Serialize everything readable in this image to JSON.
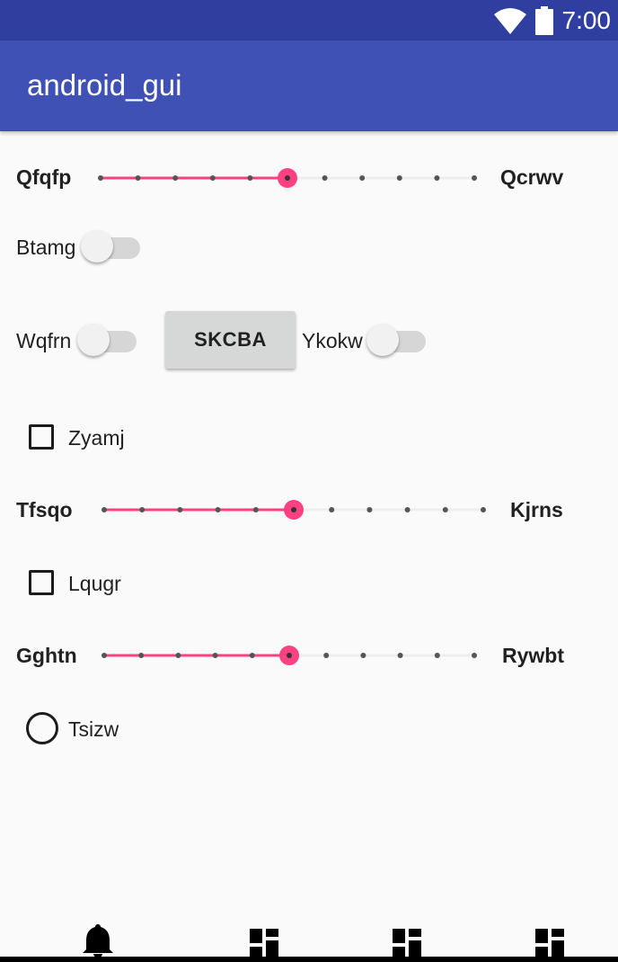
{
  "status_bar": {
    "time": "7:00",
    "icons": [
      "wifi-icon",
      "battery-icon"
    ]
  },
  "app_bar": {
    "title": "android_gui"
  },
  "slider1": {
    "left_label": "Qfqfp",
    "right_label": "Qcrwv",
    "value": 5,
    "max": 10
  },
  "switch1": {
    "label": "Btamg",
    "checked": false
  },
  "switch2": {
    "label": "Wqfrn",
    "checked": false
  },
  "button1": {
    "label": "SKCBA"
  },
  "switch3": {
    "label": "Ykokw",
    "checked": false
  },
  "checkbox1": {
    "label": "Zyamj",
    "checked": false
  },
  "slider2": {
    "left_label": "Tfsqo",
    "right_label": "Kjrns",
    "value": 5,
    "max": 10
  },
  "checkbox2": {
    "label": "Lqugr",
    "checked": false
  },
  "slider3": {
    "left_label": "Gghtn",
    "right_label": "Rywbt",
    "value": 5,
    "max": 10
  },
  "radio1": {
    "label": "Tsizw",
    "checked": false
  },
  "bottom_nav": {
    "items": [
      "bell-icon",
      "dashboard-icon",
      "dashboard-icon",
      "dashboard-icon"
    ]
  },
  "colors": {
    "accent": "#ff4081",
    "primary": "#3f51b5",
    "primary_dark": "#303f9f"
  }
}
